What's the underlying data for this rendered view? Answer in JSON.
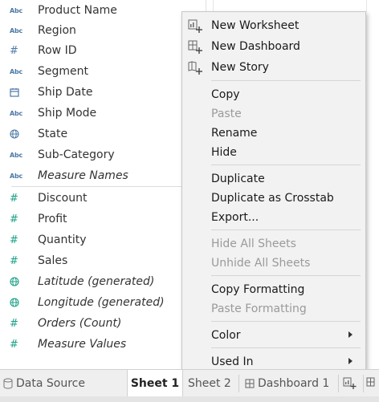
{
  "fields": {
    "dimensions": [
      {
        "type": "Abc",
        "name": "Product Name",
        "italic": false
      },
      {
        "type": "Abc",
        "name": "Region",
        "italic": false
      },
      {
        "type": "#",
        "name": "Row ID",
        "italic": false
      },
      {
        "type": "Abc",
        "name": "Segment",
        "italic": false
      },
      {
        "type": "calendar",
        "name": "Ship Date",
        "italic": false
      },
      {
        "type": "Abc",
        "name": "Ship Mode",
        "italic": false
      },
      {
        "type": "globe",
        "name": "State",
        "italic": false
      },
      {
        "type": "Abc",
        "name": "Sub-Category",
        "italic": false
      },
      {
        "type": "Abc",
        "name": "Measure Names",
        "italic": true
      }
    ],
    "measures": [
      {
        "type": "#",
        "name": "Discount",
        "italic": false
      },
      {
        "type": "#",
        "name": "Profit",
        "italic": false
      },
      {
        "type": "#",
        "name": "Quantity",
        "italic": false
      },
      {
        "type": "#",
        "name": "Sales",
        "italic": false
      },
      {
        "type": "globe",
        "name": "Latitude (generated)",
        "italic": true
      },
      {
        "type": "globe",
        "name": "Longitude (generated)",
        "italic": true
      },
      {
        "type": "#",
        "name": "Orders (Count)",
        "italic": true
      },
      {
        "type": "#",
        "name": "Measure Values",
        "italic": true
      }
    ]
  },
  "context_menu": {
    "new_worksheet": "New Worksheet",
    "new_dashboard": "New Dashboard",
    "new_story": "New Story",
    "copy": "Copy",
    "paste": "Paste",
    "rename": "Rename",
    "hide": "Hide",
    "duplicate": "Duplicate",
    "duplicate_as_crosstab": "Duplicate as Crosstab",
    "export": "Export...",
    "hide_all_sheets": "Hide All Sheets",
    "unhide_all_sheets": "Unhide All Sheets",
    "copy_formatting": "Copy Formatting",
    "paste_formatting": "Paste Formatting",
    "color": "Color",
    "used_in": "Used In"
  },
  "tabs": {
    "data_source": "Data Source",
    "sheet1": "Sheet 1",
    "sheet2": "Sheet 2",
    "dashboard1": "Dashboard 1"
  },
  "colors": {
    "dimension_icon": "#4e79a7",
    "measure_icon": "#1a9f86",
    "menu_bg": "#f2f2f2",
    "disabled_text": "#9a9a9a"
  }
}
